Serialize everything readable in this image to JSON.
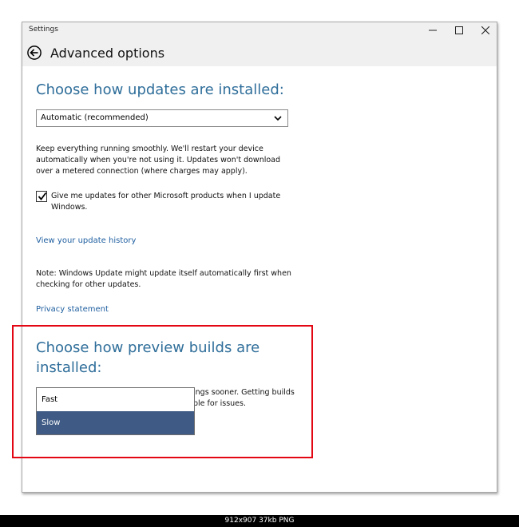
{
  "window": {
    "title": "Settings",
    "controls": [
      "minimize-icon",
      "maximize-icon",
      "close-icon"
    ]
  },
  "header": {
    "back_icon": "back-arrow-icon",
    "title": "Advanced options"
  },
  "updates": {
    "heading": "Choose how updates are installed:",
    "select_value": "Automatic (recommended)",
    "description": "Keep everything running smoothly. We'll restart your device automatically when you're not using it. Updates won't download over a metered connection (where charges may apply).",
    "checkbox_checked": true,
    "checkbox_label": "Give me updates for other Microsoft products when I update Windows.",
    "history_link": "View your update history",
    "note": "Note: Windows Update might update itself automatically first when checking for other updates.",
    "privacy_link": "Privacy statement"
  },
  "preview": {
    "heading_line1": "Choose how preview builds are",
    "heading_line2": "installed:",
    "options": [
      "Fast",
      "Slow"
    ],
    "selected": "Slow",
    "behind_text_line1": "ings sooner. Getting builds",
    "behind_text_line2": "ble for issues."
  },
  "footer": {
    "image_info": "912x907  37kb  PNG"
  },
  "colors": {
    "accent_heading": "#2f6e9a",
    "link": "#1f5fa0",
    "selected_option": "#3e5a85",
    "highlight_box": "#e30613"
  }
}
